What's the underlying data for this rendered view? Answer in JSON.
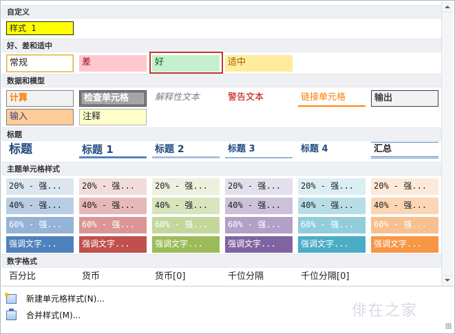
{
  "sections": {
    "custom": "自定义",
    "good_bad": "好、差和适中",
    "data_model": "数据和模型",
    "titles": "标题",
    "theme": "主题单元格样式",
    "number": "数字格式"
  },
  "custom": {
    "style1": "样式 1"
  },
  "good_bad": {
    "normal": "常规",
    "bad": "差",
    "good": "好",
    "neutral": "适中"
  },
  "data_model": {
    "calc": "计算",
    "check": "检查单元格",
    "explanatory": "解释性文本",
    "warning": "警告文本",
    "linked": "链接单元格",
    "output": "输出",
    "input": "输入",
    "note": "注释"
  },
  "titles": {
    "title": "标题",
    "h1": "标题 1",
    "h2": "标题 2",
    "h3": "标题 3",
    "h4": "标题 4",
    "total": "汇总"
  },
  "theme": {
    "pct20": "20% - 强...",
    "pct40": "40% - 强...",
    "pct60": "60% - 强...",
    "accent": "强调文字..."
  },
  "number": {
    "percent": "百分比",
    "currency": "货币",
    "currency0": "货币[0]",
    "comma": "千位分隔",
    "comma0": "千位分隔[0]"
  },
  "menu": {
    "new_style": "新建单元格样式(N)...",
    "merge": "合并样式(M)..."
  },
  "watermark": "俳在之家",
  "colors": {
    "accent1": "#4f81bd",
    "accent2": "#c0504d",
    "accent3": "#9bbb59",
    "accent4": "#8064a2",
    "accent5": "#4bacc6",
    "accent6": "#f79646"
  },
  "icons": [
    "new-style-icon",
    "merge-styles-icon",
    "scroll-up-icon",
    "scroll-down-icon"
  ]
}
